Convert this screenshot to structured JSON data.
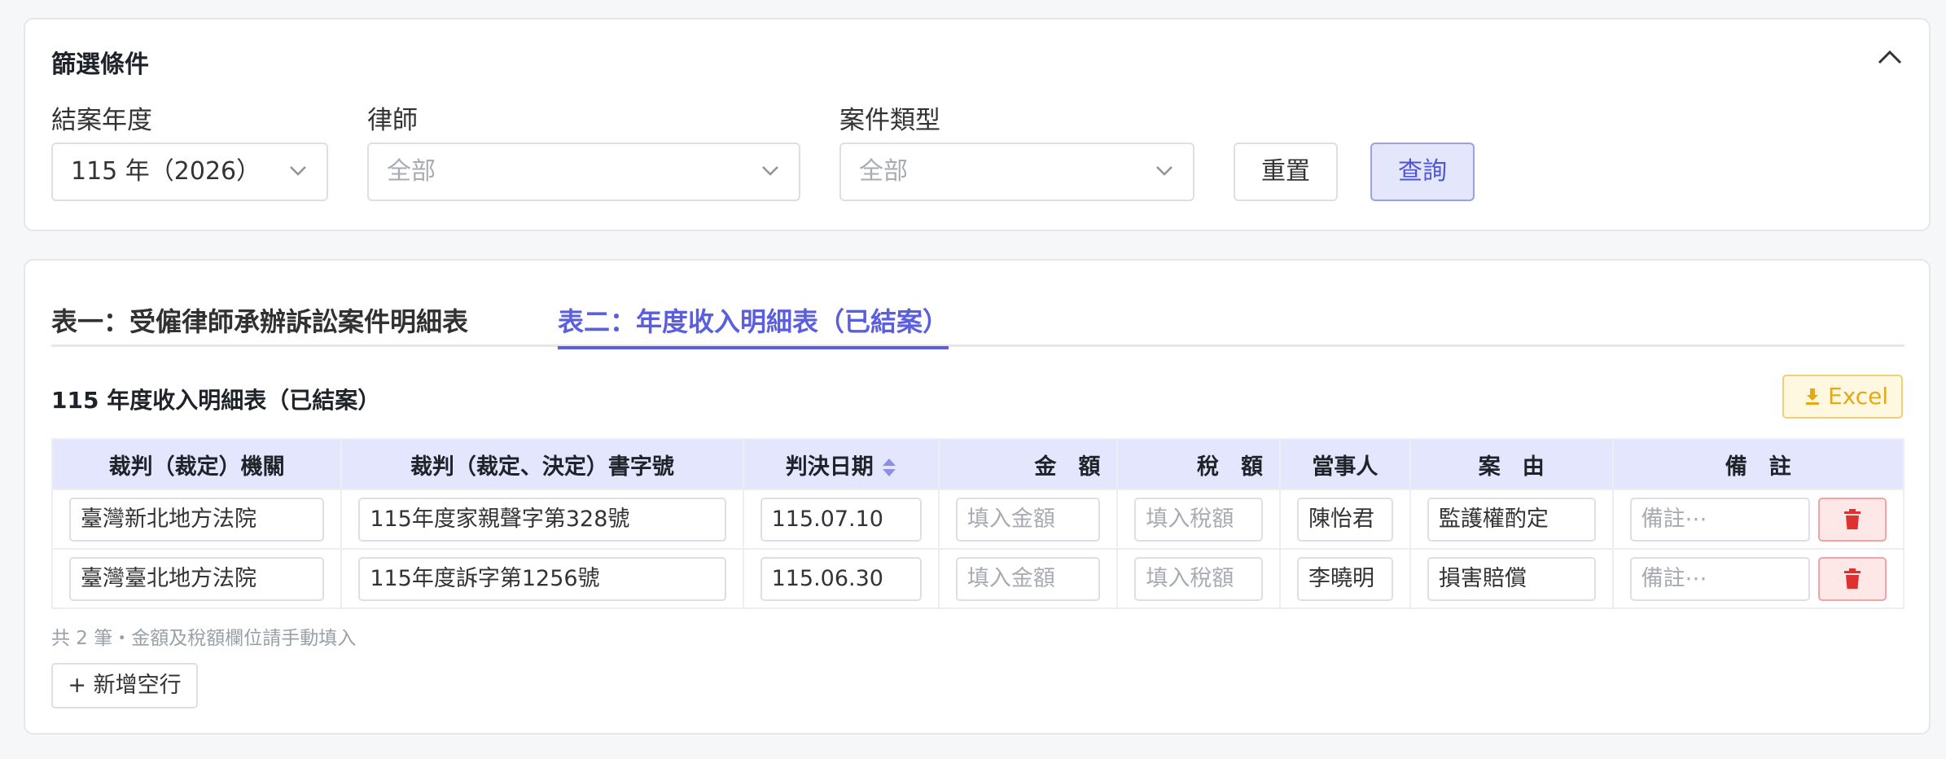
{
  "filter": {
    "title": "篩選條件",
    "year_label": "結案年度",
    "year_value": "115 年（2026）",
    "lawyer_label": "律師",
    "lawyer_value": "全部",
    "case_type_label": "案件類型",
    "case_type_value": "全部",
    "reset_label": "重置",
    "query_label": "查詢"
  },
  "tabs": [
    {
      "label": "表一：受僱律師承辦訴訟案件明細表",
      "active": false
    },
    {
      "label": "表二：年度收入明細表（已結案）",
      "active": true
    }
  ],
  "report": {
    "title": "115 年度收入明細表（已結案）",
    "excel_label": "Excel",
    "columns": [
      "裁判（裁定）機關",
      "裁判（裁定、決定）書字號",
      "判決日期",
      "金　額",
      "稅　額",
      "當事人",
      "案　由",
      "備　註"
    ],
    "rows": [
      {
        "court": "臺灣新北地方法院",
        "docket": "115年度家親聲字第328號",
        "date": "115.07.10",
        "amount": "填入金額",
        "tax": "填入稅額",
        "party": "陳怡君",
        "cause": "監護權酌定",
        "note": "備註⋯"
      },
      {
        "court": "臺灣臺北地方法院",
        "docket": "115年度訴字第1256號",
        "date": "115.06.30",
        "amount": "填入金額",
        "tax": "填入稅額",
        "party": "李曉明",
        "cause": "損害賠償",
        "note": "備註⋯"
      }
    ],
    "summary": "共 2 筆・金額及稅額欄位請手動填入",
    "add_row_label": "+ 新增空行"
  },
  "colors": {
    "accent": "#5b5fdf",
    "header_bg": "#e3e6fd",
    "excel": "#e6a817",
    "danger": "#e03131"
  }
}
